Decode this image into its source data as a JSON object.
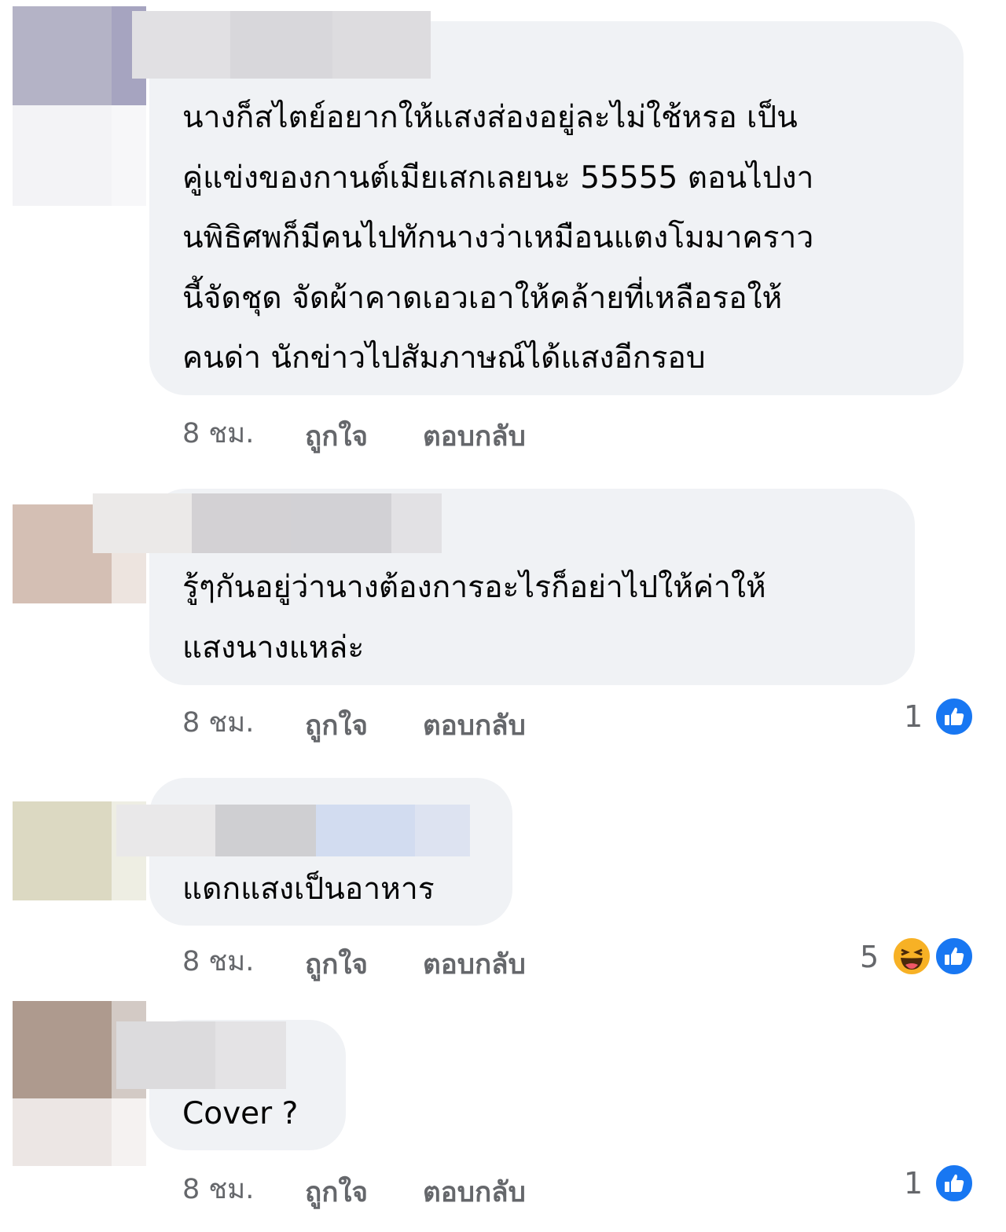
{
  "comments": [
    {
      "text": "นางก็สไตย์อยากให้แสงส่องอยู่ละไม่ใช้หรอ เป็น\nคู่แข่งของกานต์เมียเสกเลยนะ 55555 ตอนไปงา\nนพิธิศพก็มีคนไปทักนางว่าเหมือนแตงโมมาคราว\nนี้จัดชุด จัดผ้าคาดเอวเอาให้คล้ายที่เหลือรอให้\nคนด่า นักข่าวไปสัมภาษณ์ได้แสงอีกรอบ",
      "time": "8 ชม.",
      "like_label": "ถูกใจ",
      "reply_label": "ตอบกลับ",
      "reaction_count": "",
      "reactions": []
    },
    {
      "text": "รู้ๆกันอยู่ว่านางต้องการอะไรก็อย่าไปให้ค่าให้\nแสงนางแหล่ะ",
      "time": "8 ชม.",
      "like_label": "ถูกใจ",
      "reply_label": "ตอบกลับ",
      "reaction_count": "1",
      "reactions": [
        "like-icon"
      ]
    },
    {
      "text": "แดกแสงเป็นอาหาร",
      "time": "8 ชม.",
      "like_label": "ถูกใจ",
      "reply_label": "ตอบกลับ",
      "reaction_count": "5",
      "reactions": [
        "haha-icon",
        "like-icon"
      ]
    },
    {
      "text": "Cover ?",
      "time": "8 ชม.",
      "like_label": "ถูกใจ",
      "reply_label": "ตอบกลับ",
      "reaction_count": "1",
      "reactions": [
        "like-icon"
      ]
    }
  ],
  "colors": {
    "bubble": "#f0f2f5",
    "meta_text": "#65676b",
    "like_blue": "#1877f2",
    "haha_yellow": "#f7b125"
  }
}
